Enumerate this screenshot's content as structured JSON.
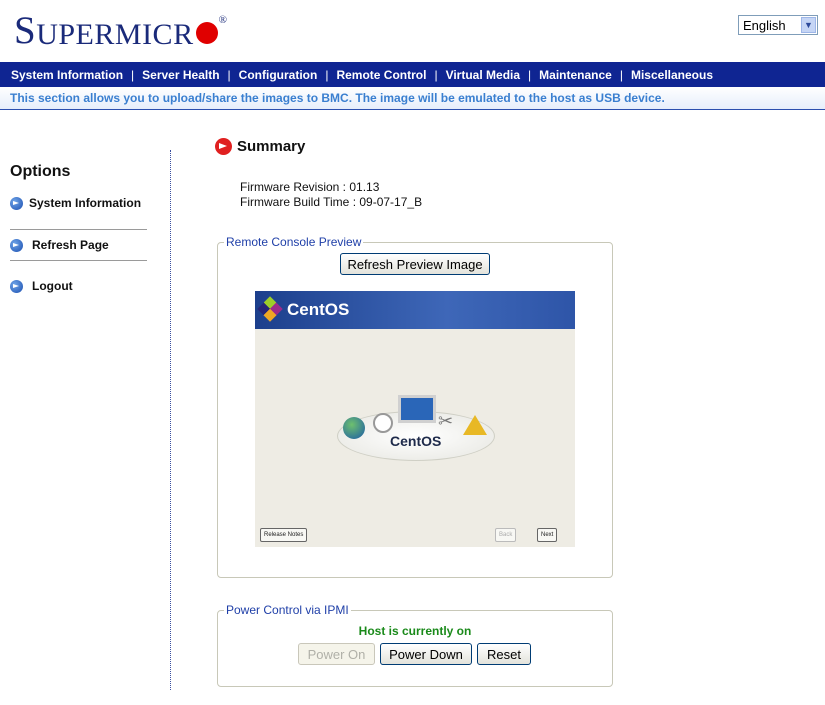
{
  "header": {
    "logo": {
      "first_letter": "S",
      "rest": "UPERMICR",
      "registered": "®"
    },
    "language": {
      "selected": "English"
    }
  },
  "navbar": {
    "items": [
      "System Information",
      "Server Health",
      "Configuration",
      "Remote Control",
      "Virtual Media",
      "Maintenance",
      "Miscellaneous"
    ]
  },
  "info": {
    "text": "This section allows you to upload/share the images to BMC. The image will be emulated to the host as USB device."
  },
  "sidebar": {
    "title": "Options",
    "items": [
      {
        "label": "System Information"
      },
      {
        "label": "Refresh Page"
      },
      {
        "label": "Logout"
      }
    ]
  },
  "summary": {
    "title": "Summary",
    "firmware_revision": "Firmware Revision : 01.13",
    "firmware_build_time": "Firmware Build Time : 09-07-17_B"
  },
  "remote_console": {
    "legend": "Remote Console Preview",
    "refresh_button": "Refresh Preview Image",
    "preview": {
      "brand": "CentOS",
      "center_text": "CentOS",
      "release_notes_button": "Release Notes",
      "back_button": "Back",
      "next_button": "Next"
    }
  },
  "power_control": {
    "legend": "Power Control via IPMI",
    "status": "Host is currently on",
    "buttons": {
      "power_on": "Power On",
      "power_down": "Power Down",
      "reset": "Reset"
    },
    "status_color": "#1a8a1a"
  },
  "colors": {
    "nav_bg": "#0f2592",
    "logo_red": "#e00000",
    "logo_blue": "#1a2a7a"
  }
}
